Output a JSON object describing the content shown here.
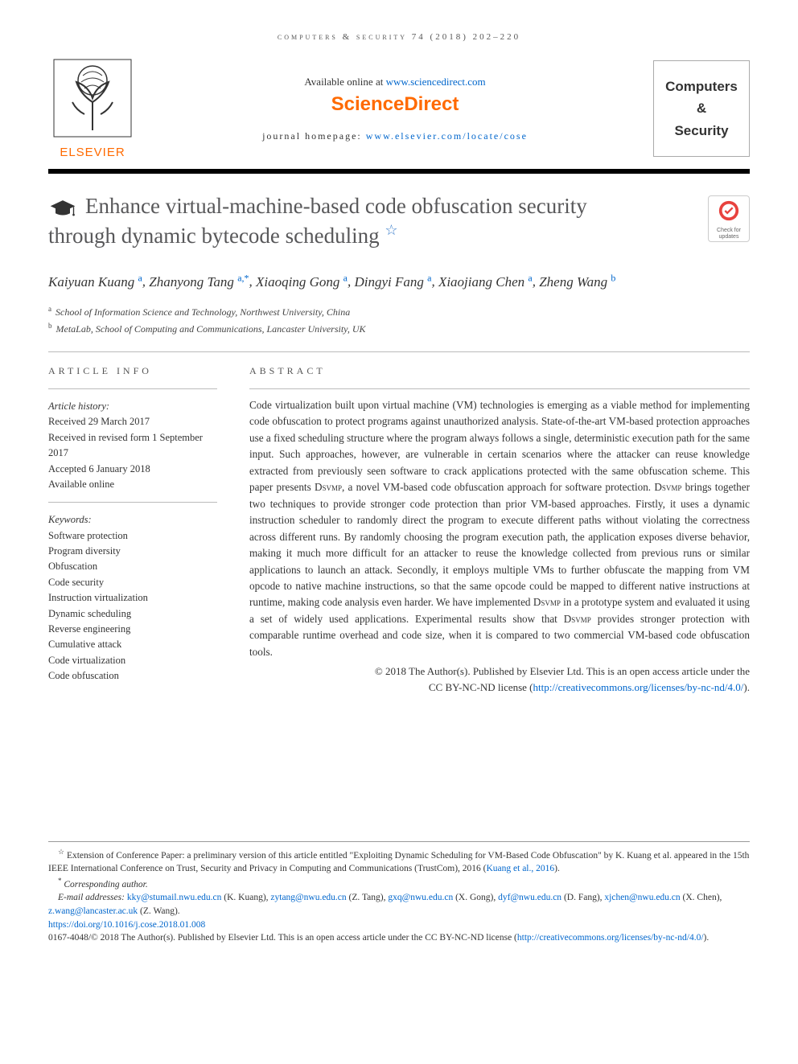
{
  "running_header": "computers & security 74 (2018) 202–220",
  "masthead": {
    "available_prefix": "Available online at ",
    "available_link": "www.sciencedirect.com",
    "sd_logo": "ScienceDirect",
    "homepage_prefix": "journal homepage: ",
    "homepage_link": "www.elsevier.com/locate/cose",
    "elsevier": "ELSEVIER",
    "journal_line1": "Computers",
    "journal_line2": "&",
    "journal_line3": "Security"
  },
  "check_updates": "Check for updates",
  "title": "Enhance virtual-machine-based code obfuscation security through dynamic bytecode scheduling",
  "title_star": "☆",
  "authors": [
    {
      "name": "Kaiyuan Kuang",
      "aff": "a"
    },
    {
      "name": "Zhanyong Tang",
      "aff": "a",
      "corr": "*"
    },
    {
      "name": "Xiaoqing Gong",
      "aff": "a"
    },
    {
      "name": "Dingyi Fang",
      "aff": "a"
    },
    {
      "name": "Xiaojiang Chen",
      "aff": "a"
    },
    {
      "name": "Zheng Wang",
      "aff": "b"
    }
  ],
  "affiliations": {
    "a": "School of Information Science and Technology, Northwest University, China",
    "b": "MetaLab, School of Computing and Communications, Lancaster University, UK"
  },
  "info_label": "ARTICLE INFO",
  "abstract_label": "ABSTRACT",
  "history": {
    "head": "Article history:",
    "received": "Received 29 March 2017",
    "revised": "Received in revised form 1 September 2017",
    "accepted": "Accepted 6 January 2018",
    "online": "Available online"
  },
  "keywords_head": "Keywords:",
  "keywords": [
    "Software protection",
    "Program diversity",
    "Obfuscation",
    "Code security",
    "Instruction virtualization",
    "Dynamic scheduling",
    "Reverse engineering",
    "Cumulative attack",
    "Code virtualization",
    "Code obfuscation"
  ],
  "abstract": "Code virtualization built upon virtual machine (VM) technologies is emerging as a viable method for implementing code obfuscation to protect programs against unauthorized analysis. State-of-the-art VM-based protection approaches use a fixed scheduling structure where the program always follows a single, deterministic execution path for the same input. Such approaches, however, are vulnerable in certain scenarios where the attacker can reuse knowledge extracted from previously seen software to crack applications protected with the same obfuscation scheme. This paper presents Dsvmp, a novel VM-based code obfuscation approach for software protection. Dsvmp brings together two techniques to provide stronger code protection than prior VM-based approaches. Firstly, it uses a dynamic instruction scheduler to randomly direct the program to execute different paths without violating the correctness across different runs. By randomly choosing the program execution path, the application exposes diverse behavior, making it much more difficult for an attacker to reuse the knowledge collected from previous runs or similar applications to launch an attack. Secondly, it employs multiple VMs to further obfuscate the mapping from VM opcode to native machine instructions, so that the same opcode could be mapped to different native instructions at runtime, making code analysis even harder. We have implemented Dsvmp in a prototype system and evaluated it using a set of widely used applications. Experimental results show that Dsvmp provides stronger protection with comparable runtime overhead and code size, when it is compared to two commercial VM-based code obfuscation tools.",
  "copyright": {
    "line1": "© 2018 The Author(s). Published by Elsevier Ltd. This is an open access article under the",
    "line2_prefix": "CC BY-NC-ND license (",
    "license_link": "http://creativecommons.org/licenses/by-nc-nd/4.0/",
    "line2_suffix": ")."
  },
  "footnotes": {
    "star_note_prefix": "Extension of Conference Paper: a preliminary version of this article entitled \"Exploiting Dynamic Scheduling for VM-Based Code Obfuscation\" by K. Kuang et al. appeared in the 15th IEEE International Conference on Trust, Security and Privacy in Computing and Communications (TrustCom), 2016 (",
    "star_cite": "Kuang et al., 2016",
    "star_note_suffix": ").",
    "corr_note": "Corresponding author.",
    "email_label": "E-mail addresses:",
    "emails": [
      {
        "addr": "kky@stumail.nwu.edu.cn",
        "who": "(K. Kuang)"
      },
      {
        "addr": "zytang@nwu.edu.cn",
        "who": "(Z. Tang)"
      },
      {
        "addr": "gxq@nwu.edu.cn",
        "who": "(X. Gong)"
      },
      {
        "addr": "dyf@nwu.edu.cn",
        "who": "(D. Fang)"
      },
      {
        "addr": "xjchen@nwu.edu.cn",
        "who": "(X. Chen)"
      },
      {
        "addr": "z.wang@lancaster.ac.uk",
        "who": "(Z. Wang)"
      }
    ],
    "doi": "https://doi.org/10.1016/j.cose.2018.01.008",
    "issn_line_prefix": "0167-4048/© 2018 The Author(s). Published by Elsevier Ltd. This is an open access article under the CC BY-NC-ND license (",
    "issn_link": "http://creativecommons.org/licenses/by-nc-nd/4.0/",
    "issn_line_suffix": ")."
  }
}
